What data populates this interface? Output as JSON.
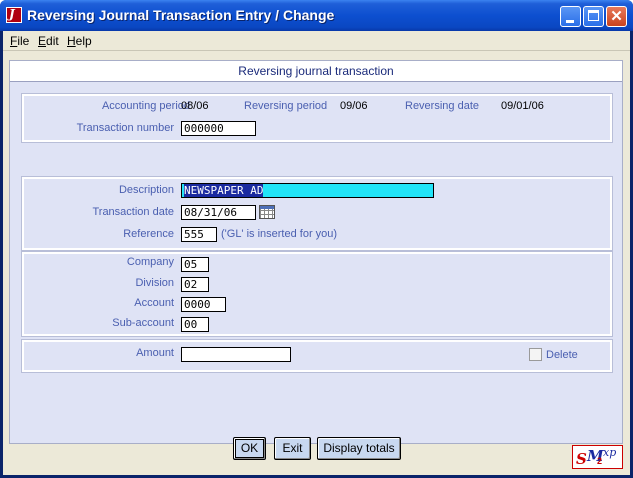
{
  "window": {
    "title": "Reversing Journal Transaction Entry / Change",
    "app_icon_glyph": "J"
  },
  "menu": {
    "items": [
      {
        "label": "File",
        "accel": "F",
        "rest": "ile"
      },
      {
        "label": "Edit",
        "accel": "E",
        "rest": "dit"
      },
      {
        "label": "Help",
        "accel": "H",
        "rest": "elp"
      }
    ]
  },
  "form": {
    "heading": "Reversing journal transaction",
    "accounting_period": {
      "label": "Accounting period",
      "value": "08/06"
    },
    "reversing_period": {
      "label": "Reversing period",
      "value": "09/06"
    },
    "reversing_date": {
      "label": "Reversing date",
      "value": "09/01/06"
    },
    "transaction_number": {
      "label": "Transaction number",
      "value": "000000"
    },
    "description": {
      "label": "Description",
      "value": "NEWSPAPER AD"
    },
    "transaction_date": {
      "label": "Transaction  date",
      "value": "08/31/06"
    },
    "reference": {
      "label": "Reference",
      "value": "555",
      "hint": "('GL' is inserted for you)"
    },
    "company": {
      "label": "Company",
      "value": "05"
    },
    "division": {
      "label": "Division",
      "value": "02"
    },
    "account": {
      "label": "Account",
      "value": "0000"
    },
    "sub_account": {
      "label": "Sub-account",
      "value": "00"
    },
    "amount": {
      "label": "Amount",
      "value": ""
    },
    "delete": {
      "label": "Delete",
      "checked": false
    }
  },
  "buttons": {
    "ok": "OK",
    "exit": "Exit",
    "display_totals": "Display totals"
  },
  "logo": {
    "s": "S",
    "m": "M",
    "two": "2",
    "xp": "xp"
  },
  "colors": {
    "label_blue": "#4a5fb0",
    "panel_bg": "#dfe3f5",
    "highlight_cyan": "#22e4f8",
    "selection_navy": "#1a2aa0"
  }
}
